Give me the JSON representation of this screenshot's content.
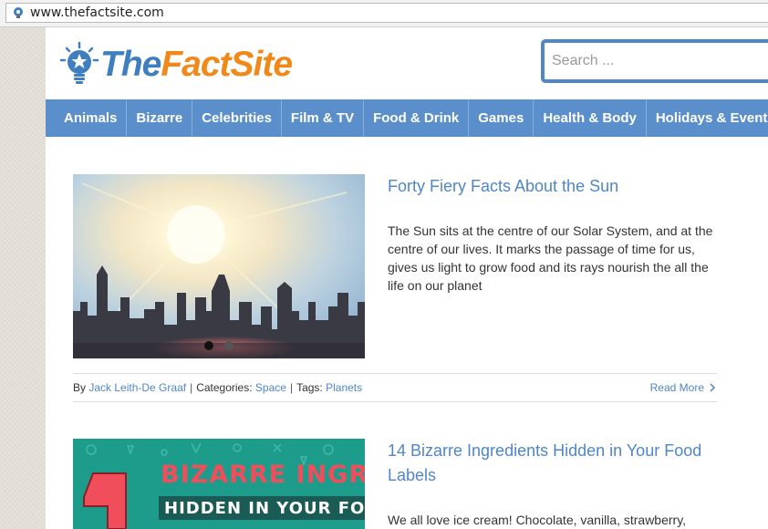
{
  "browser": {
    "url": "www.thefactsite.com"
  },
  "logo": {
    "part1": "The",
    "part2": "Fact",
    "part3": "Site"
  },
  "search": {
    "placeholder": "Search ..."
  },
  "nav": {
    "items": [
      "Animals",
      "Bizarre",
      "Celebrities",
      "Film & TV",
      "Food & Drink",
      "Games",
      "Health & Body",
      "Holidays & Events"
    ]
  },
  "articles": [
    {
      "title": "Forty Fiery Facts About the Sun",
      "excerpt": "The Sun sits at the centre of our Solar System, and at the centre of our lives. It marks the passage of time for us, gives us light to grow food and its rays nourish the all the life on our planet",
      "meta": {
        "by_label": "By",
        "author": "Jack Leith-De Graaf",
        "categories_label": "Categories:",
        "category": "Space",
        "tags_label": "Tags:",
        "tag": "Planets",
        "read_more": "Read More"
      }
    },
    {
      "title": "14 Bizarre Ingredients Hidden in Your Food Labels",
      "excerpt": "We all love ice cream! Chocolate, vanilla, strawberry,",
      "image_text": {
        "number": "4",
        "line1": "BIZARRE INGREDIENTS",
        "line2": "HIDDEN IN YOUR FOOD LABELS"
      }
    }
  ],
  "colors": {
    "brand_blue": "#5b8fcb",
    "link_blue": "#4f86c6",
    "brand_orange": "#f0891a"
  }
}
